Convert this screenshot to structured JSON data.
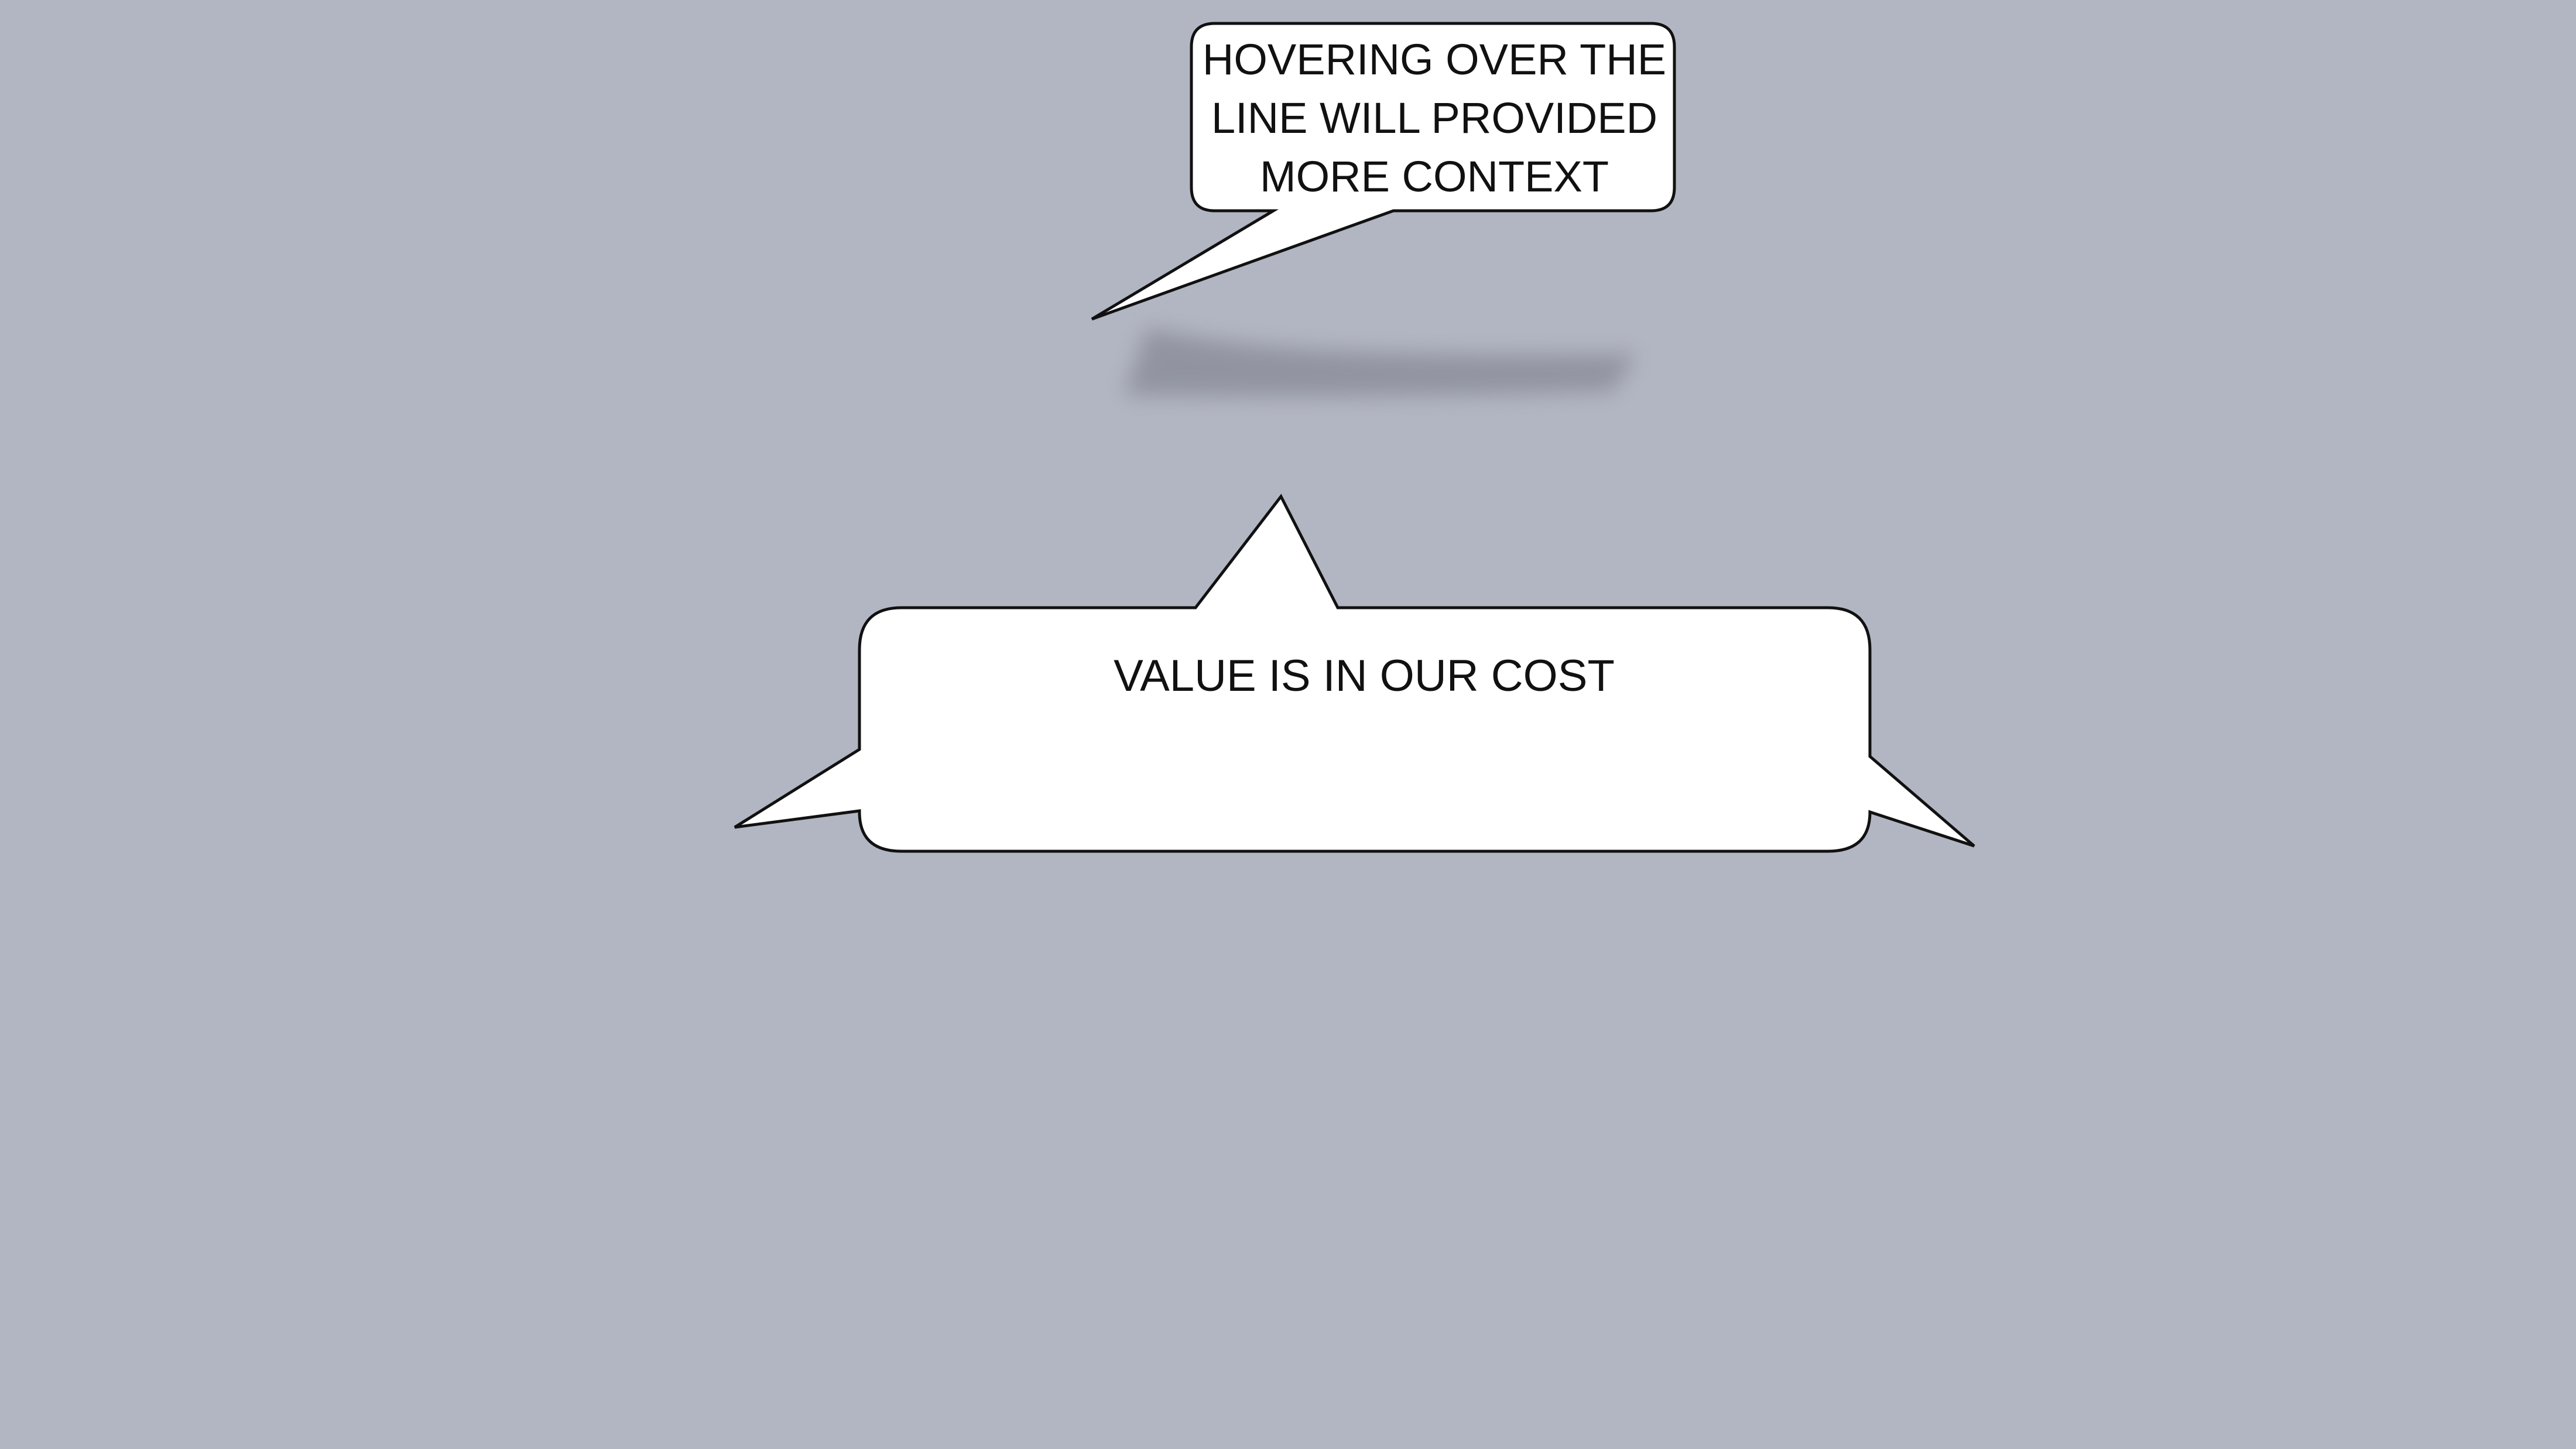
{
  "canvas": {
    "background": "#b2b6c2"
  },
  "callouts": {
    "top": {
      "text": "HOVERING OVER THE\nLINE WILL PROVIDED\nMORE CONTEXT",
      "fill": "#ffffff",
      "stroke": "#111111"
    },
    "main": {
      "text": "VALUE IS IN OUR COST",
      "fill": "#ffffff",
      "stroke": "#111111"
    }
  },
  "shadow": {
    "color": "#8e919d"
  }
}
